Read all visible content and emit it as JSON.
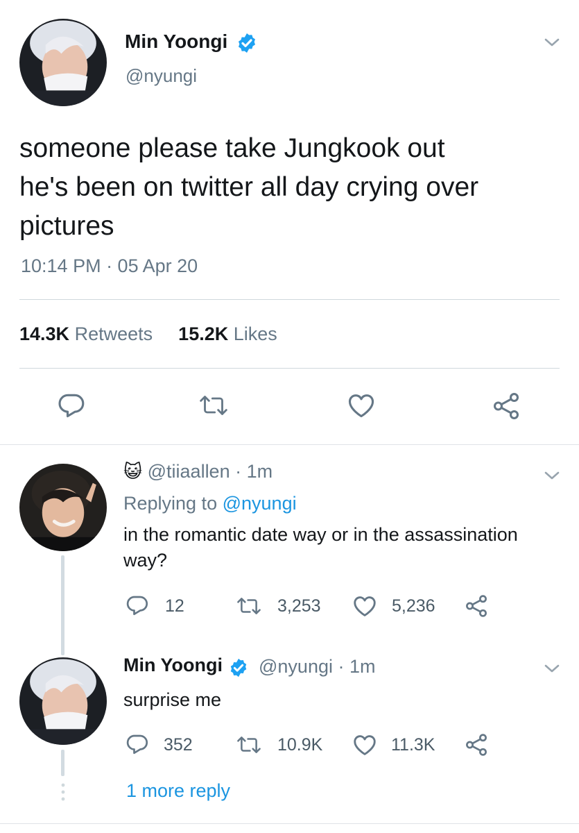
{
  "main_tweet": {
    "author_name": "Min Yoongi",
    "handle": "@nyungi",
    "text_line1": "someone please take Jungkook out",
    "text_line2": "he's been on twitter all day crying over",
    "text_line3": "pictures",
    "timestamp": "10:14 PM · 05 Apr 20",
    "retweets_count": "14.3K",
    "retweets_label": "Retweets",
    "likes_count": "15.2K",
    "likes_label": "Likes",
    "verified": true
  },
  "replies": [
    {
      "emoji": "😺",
      "handle": "@tiiaallen",
      "time": "· 1m",
      "replying_prefix": "Replying to",
      "replying_handle": "@nyungi",
      "text_line1": "in the romantic date way or in the assassination",
      "text_line2": "way?",
      "reply_count": "12",
      "retweet_count": "3,253",
      "like_count": "5,236"
    },
    {
      "author_name": "Min Yoongi",
      "handle": "@nyungi",
      "time": "· 1m",
      "text_line1": "surprise me",
      "reply_count": "352",
      "retweet_count": "10.9K",
      "like_count": "11.3K",
      "verified": true
    }
  ],
  "thread": {
    "more_replies_label": "1 more reply"
  },
  "colors": {
    "accent": "#1b95e0",
    "secondary_text": "#657786",
    "icon": "#657786",
    "divider": "#cfd8dc"
  }
}
